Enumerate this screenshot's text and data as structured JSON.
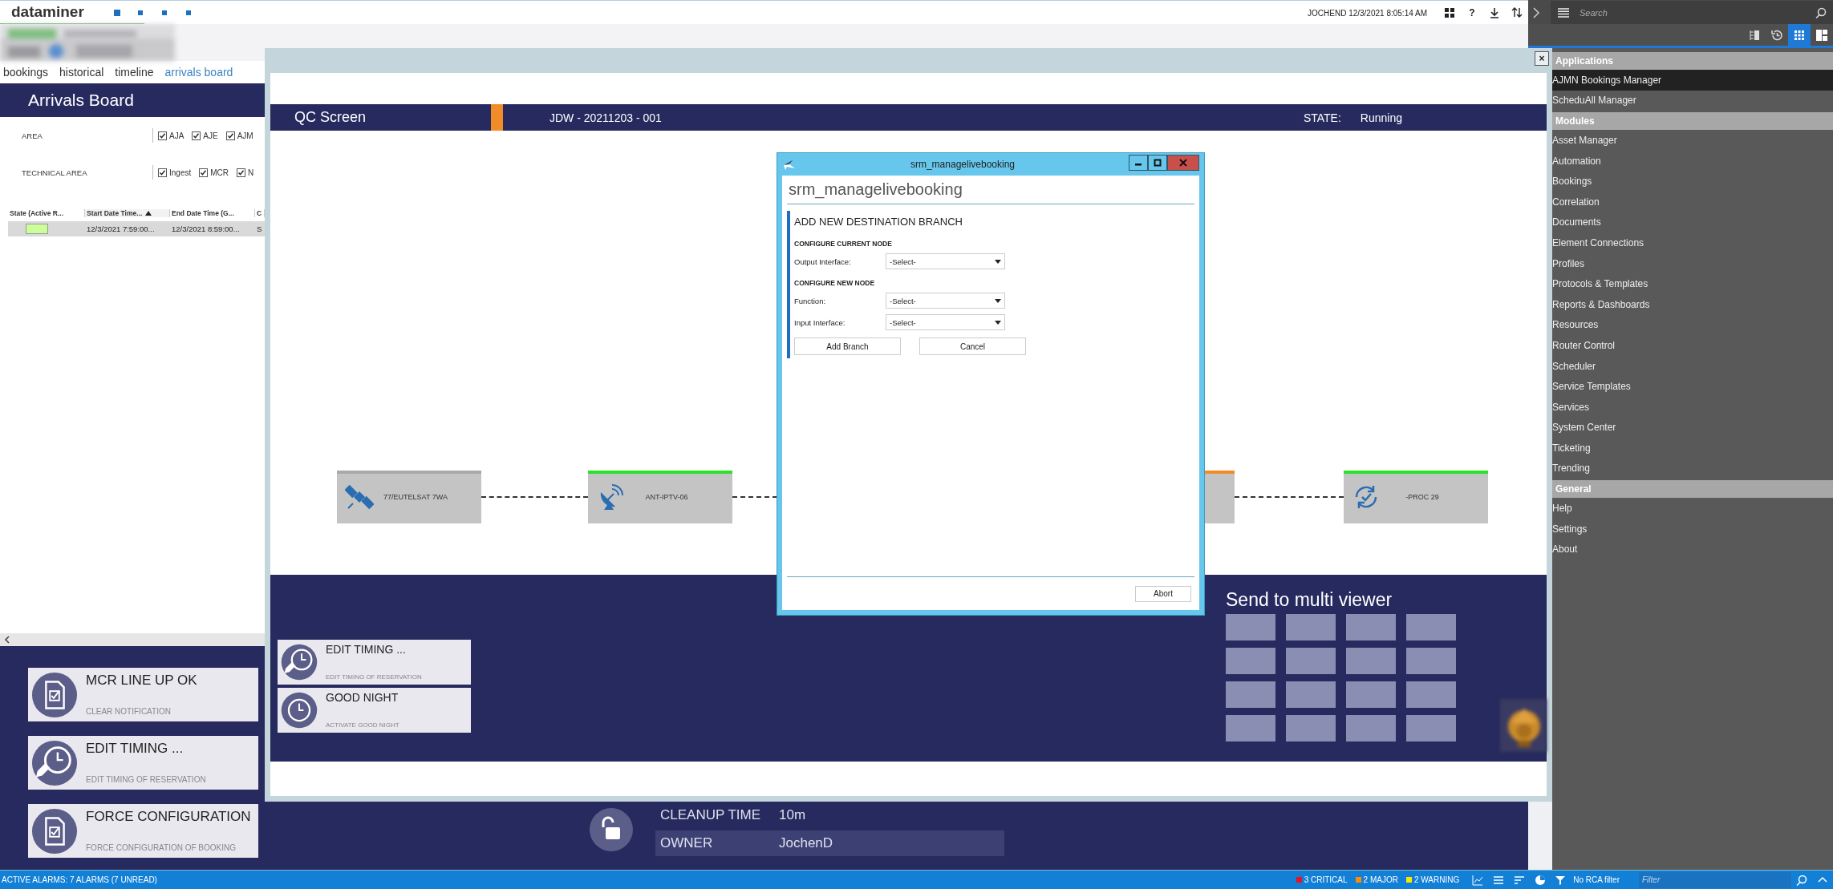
{
  "topbar": {
    "logo": "dataminer",
    "user_time": "JOCHEND 12/3/2021 8:05:14 AM",
    "help": "?",
    "search": {
      "placeholder": "Search"
    }
  },
  "tabs": [
    {
      "label": "bookings",
      "selected": false
    },
    {
      "label": "historical",
      "selected": false
    },
    {
      "label": "timeline",
      "selected": false
    },
    {
      "label": "arrivals board",
      "selected": true
    }
  ],
  "arrivals_board": {
    "title": "Arrivals Board",
    "filters": [
      {
        "label": "AREA",
        "options": [
          {
            "label": "AJA",
            "checked": true
          },
          {
            "label": "AJE",
            "checked": true
          },
          {
            "label": "AJM",
            "checked": true
          }
        ]
      },
      {
        "label": "TECHNICAL AREA",
        "options": [
          {
            "label": "Ingest",
            "checked": true
          },
          {
            "label": "MCR",
            "checked": true
          },
          {
            "label": "N",
            "checked": true
          }
        ]
      }
    ],
    "table": {
      "columns": [
        {
          "label": "State (Active R...",
          "sorted": false
        },
        {
          "label": "Start Date Time...",
          "sorted": true
        },
        {
          "label": "End Date Time (G...",
          "sorted": false
        },
        {
          "label": "C",
          "sorted": false
        }
      ],
      "rows": [
        {
          "selected": true,
          "color": "#ccff99",
          "cells": [
            "",
            "12/3/2021 7:59:00...",
            "12/3/2021 8:59:00...",
            "S"
          ]
        }
      ]
    }
  },
  "actions": [
    {
      "kind": "document",
      "title": "MCR LINE UP OK",
      "subtitle": "CLEAR NOTIFICATION"
    },
    {
      "kind": "clock-edit",
      "title": "EDIT TIMING ...",
      "subtitle": "EDIT TIMING OF RESERVATION"
    },
    {
      "kind": "document",
      "title": "FORCE CONFIGURATION",
      "subtitle": "FORCE CONFIGURATION OF BOOKING"
    }
  ],
  "booking_info": [
    {
      "label": "CLEANUP TIME",
      "value": "10m",
      "highlighted": false
    },
    {
      "label": "OWNER",
      "value": "JochenD",
      "highlighted": true
    }
  ],
  "qc_screen": {
    "close": "×",
    "title": "QC Screen",
    "job": "JDW - 20211203 - 001",
    "state_label": "STATE:",
    "state": "Running",
    "nodes": [
      {
        "kind": "satellite",
        "label": "77/EUTELSAT 7WA",
        "color": "#a9a9a9"
      },
      {
        "kind": "dish",
        "label": "ANT-IPTV-06",
        "color": "#2ee02e"
      },
      {
        "kind": "generic",
        "color": "#f28c28"
      },
      {
        "kind": "process",
        "label": "-PROC 29",
        "color": "#2ee02e"
      }
    ],
    "actions": [
      {
        "kind": "clock-edit",
        "title": "EDIT TIMING ...",
        "subtitle": "EDIT TIMING OF RESERVATION"
      },
      {
        "kind": "clock",
        "title": "GOOD NIGHT",
        "subtitle": "ACTIVATE GOOD NIGHT"
      }
    ],
    "multiviewer": {
      "title": "Send to multi viewer"
    }
  },
  "dialog": {
    "window_title": "srm_managelivebooking",
    "heading": "srm_managelivebooking",
    "section": "ADD NEW DESTINATION BRANCH",
    "groups": [
      {
        "title": "CONFIGURE CURRENT NODE",
        "fields": [
          {
            "label": "Output Interface:",
            "value": "-Select-"
          }
        ]
      },
      {
        "title": "CONFIGURE NEW NODE",
        "fields": [
          {
            "label": "Function:",
            "value": "-Select-"
          },
          {
            "label": "Input Interface:",
            "value": "-Select-"
          }
        ]
      }
    ],
    "buttons": [
      "Add Branch",
      "Cancel"
    ],
    "footer_button": "Abort"
  },
  "sidebar": {
    "view_buttons": [
      {
        "kind": "tree",
        "selected": false
      },
      {
        "kind": "history",
        "selected": false
      },
      {
        "kind": "grid",
        "selected": true
      },
      {
        "kind": "layout",
        "selected": false
      }
    ],
    "sections": [
      {
        "title": "Applications",
        "items": [
          {
            "label": "AJMN Bookings Manager",
            "selected": true
          },
          {
            "label": "ScheduAll Manager",
            "selected": false
          }
        ]
      },
      {
        "title": "Modules",
        "items": [
          {
            "label": "Asset Manager",
            "selected": false
          },
          {
            "label": "Automation",
            "selected": false
          },
          {
            "label": "Bookings",
            "selected": false
          },
          {
            "label": "Correlation",
            "selected": false
          },
          {
            "label": "Documents",
            "selected": false
          },
          {
            "label": "Element Connections",
            "selected": false
          },
          {
            "label": "Profiles",
            "selected": false
          },
          {
            "label": "Protocols & Templates",
            "selected": false
          },
          {
            "label": "Reports & Dashboards",
            "selected": false
          },
          {
            "label": "Resources",
            "selected": false
          },
          {
            "label": "Router Control",
            "selected": false
          },
          {
            "label": "Scheduler",
            "selected": false
          },
          {
            "label": "Service Templates",
            "selected": false
          },
          {
            "label": "Services",
            "selected": false
          },
          {
            "label": "System Center",
            "selected": false
          },
          {
            "label": "Ticketing",
            "selected": false
          },
          {
            "label": "Trending",
            "selected": false
          }
        ]
      },
      {
        "title": "General",
        "items": [
          {
            "label": "Help",
            "selected": false
          },
          {
            "label": "Settings",
            "selected": false
          },
          {
            "label": "About",
            "selected": false
          }
        ]
      }
    ]
  },
  "status_bar": {
    "alarms": "ACTIVE ALARMS: 7 ALARMS (7 UNREAD)",
    "counters": [
      {
        "label": "3 CRITICAL",
        "color": "#e81123"
      },
      {
        "label": "2 MAJOR",
        "color": "#ff8c00"
      },
      {
        "label": "2 WARNING",
        "color": "#ffe600"
      }
    ],
    "rca_filter": "No RCA filter",
    "filter": {
      "placeholder": "Filter"
    }
  }
}
